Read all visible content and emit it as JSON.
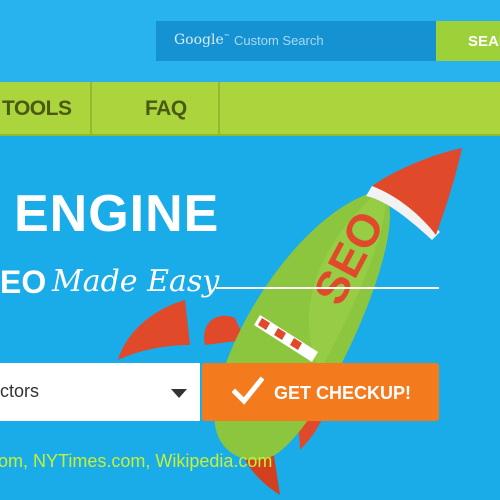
{
  "search": {
    "logo_text": "Google",
    "placeholder": "Custom Search",
    "button_label": "SEARCH"
  },
  "nav": {
    "items": [
      {
        "label": "TOOLS"
      },
      {
        "label": "FAQ"
      }
    ]
  },
  "hero": {
    "headline": "ENGINE",
    "tagline_bold": "EO",
    "tagline_script": "Made Easy",
    "rocket_text": "SEO"
  },
  "form": {
    "select_value": "ctors",
    "submit_label": "GET CHECKUP!"
  },
  "examples_text": "om, NYTimes.com, Wikipedia.com",
  "colors": {
    "background": "#1aabe9",
    "nav": "#abd43d",
    "search_button": "#9dd13a",
    "cta": "#f47a1e",
    "rocket_green": "#8cc63f",
    "rocket_red": "#e04a2a"
  }
}
